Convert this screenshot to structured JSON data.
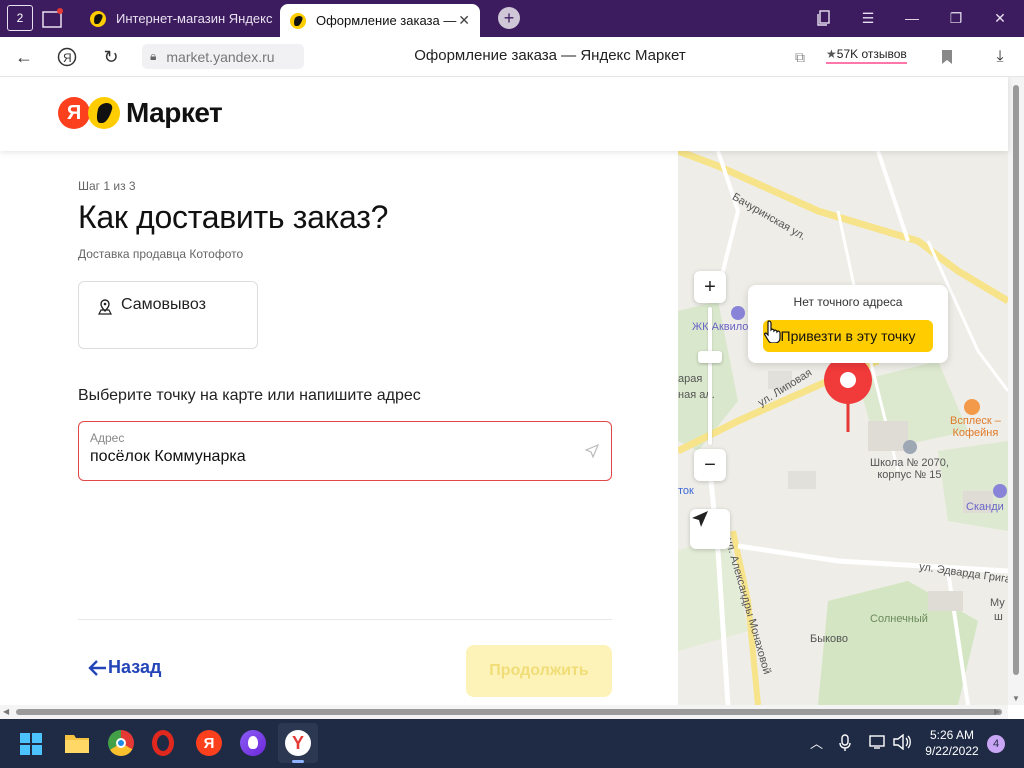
{
  "browser": {
    "tab_count": "2",
    "tabs": [
      {
        "title": "Интернет-магазин Яндекс"
      },
      {
        "title": "Оформление заказа —"
      }
    ],
    "url": "market.yandex.ru",
    "page_title": "Оформление заказа — Яндекс Маркет",
    "reviews": "57K отзывов"
  },
  "header": {
    "logo_letter": "Я",
    "logo_text": "Маркет"
  },
  "checkout": {
    "step": "Шаг 1 из 3",
    "title": "Как доставить заказ?",
    "seller": "Доставка продавца Котофото",
    "pickup_label": "Самовывоз",
    "choose_text": "Выберите точку на карте или напишите адрес",
    "address_label": "Адрес",
    "address_value": "посёлок Коммунарка",
    "back_label": "Назад",
    "continue_label": "Продолжить"
  },
  "map": {
    "popup_title": "Нет точного адреса",
    "popup_button": "Привезти в эту точку",
    "labels": {
      "bachurinskaya": "Бачуринская ул.",
      "akvilon": "ЖК Аквилон",
      "lipovaya": "ул. Липовая",
      "vsplesk1": "Всплеск –",
      "vsplesk2": "Кофейня",
      "school1": "Школа № 2070,",
      "school2": "корпус № 15",
      "scandi": "Сканди",
      "monakhovoy": "ул. Александры Монаховой",
      "griga": "ул. Эдварда Грига",
      "solnechny": "Солнечный",
      "bykovo": "Быково",
      "stok": "ток",
      "arya": "арая",
      "nayaal": "ная ал.",
      "mu": "Му",
      "sh": "ш"
    }
  },
  "taskbar": {
    "time": "5:26 AM",
    "date": "9/22/2022",
    "notifications": "4"
  }
}
